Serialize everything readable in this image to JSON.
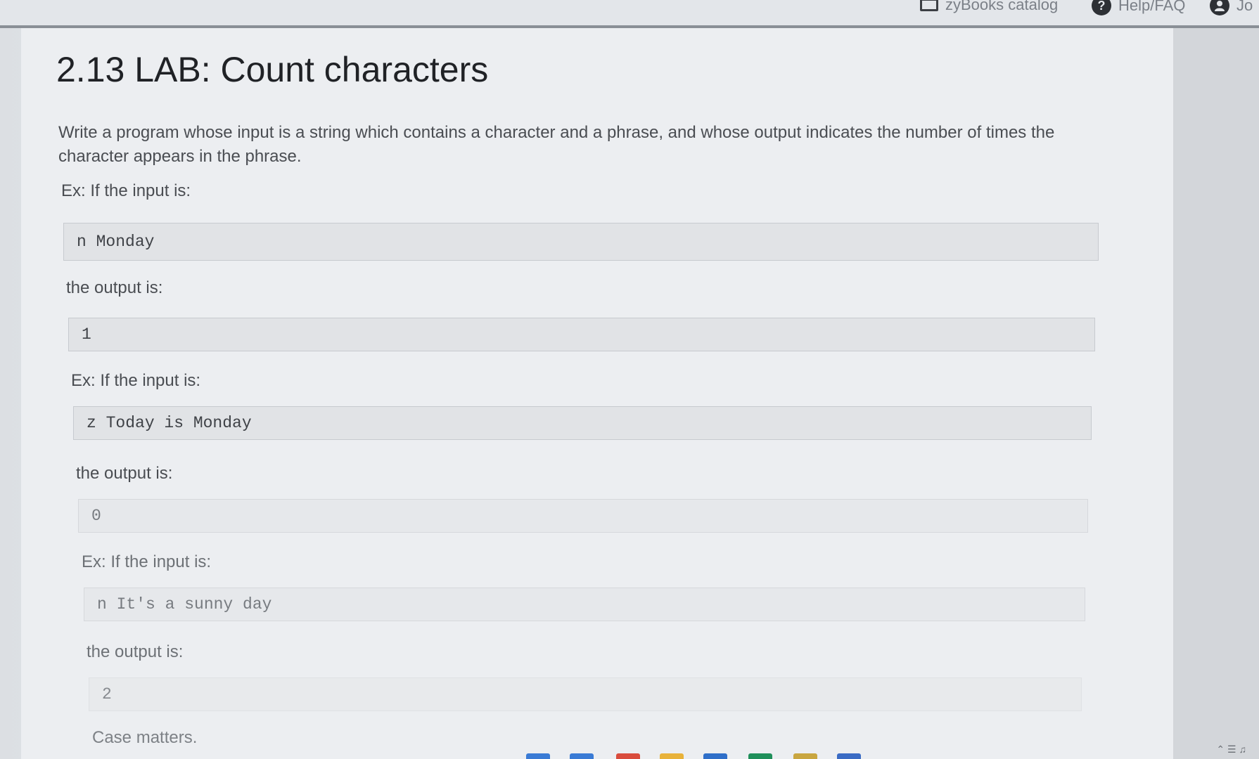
{
  "header": {
    "catalog_label": "zyBooks catalog",
    "help_label": "Help/FAQ",
    "help_icon_glyph": "?",
    "user_label": "Jo"
  },
  "lab": {
    "title": "2.13 LAB: Count characters",
    "intro": "Write a program whose input is a string which contains a character and a phrase, and whose output indicates the number of times the character appears in the phrase.",
    "examples": [
      {
        "input_label": "Ex: If the input is:",
        "input": "n Monday",
        "output_label": "the output is:",
        "output": "1"
      },
      {
        "input_label": "Ex: If the input is:",
        "input": "z Today is Monday",
        "output_label": "the output is:",
        "output": "0"
      },
      {
        "input_label": "Ex: If the input is:",
        "input": "n It's a sunny day",
        "output_label": "the output is:",
        "output": "2"
      }
    ],
    "note": "Case matters."
  },
  "taskbar": {
    "icon_colors": [
      "#3a7bd5",
      "#3a7bd5",
      "#d94c3d",
      "#e8b23a",
      "#2f6fc9",
      "#1f8f5a",
      "#c9a640",
      "#3a6bc4"
    ],
    "tray_icons": [
      "chevron-up-icon",
      "wifi-icon",
      "volume-icon"
    ]
  },
  "colors": {
    "page_bg": "#eceef1",
    "code_bg": "#e1e3e6",
    "title_text": "#202226",
    "body_text": "#4a4d52"
  }
}
